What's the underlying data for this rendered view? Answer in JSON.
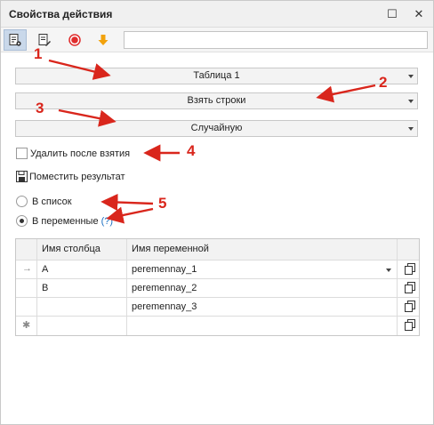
{
  "window": {
    "title": "Свойства действия",
    "maximize_glyph": "☐",
    "close_glyph": "✕"
  },
  "toolbar": {
    "icons": [
      "properties-icon",
      "notes-icon",
      "record-icon",
      "arrow-down-icon"
    ],
    "search_value": ""
  },
  "form": {
    "table_select": "Таблица 1",
    "action_select": "Взять строки",
    "mode_select": "Случайную",
    "delete_after_label": "Удалить после взятия",
    "delete_after_checked": false,
    "place_result_label": "Поместить результат",
    "to_list_label": "В список",
    "to_vars_label": "В переменные",
    "help_label": "(?)",
    "selected_option": "to_vars"
  },
  "grid": {
    "headers": [
      "Имя столбца",
      "Имя переменной"
    ],
    "rows": [
      {
        "column": "A",
        "variable": "peremennay_1",
        "has_dropdown": true
      },
      {
        "column": "B",
        "variable": "peremennay_2",
        "has_dropdown": false
      },
      {
        "column": "",
        "variable": "peremennay_3",
        "has_dropdown": false
      },
      {
        "column": "",
        "variable": "",
        "has_dropdown": false
      }
    ],
    "row_markers": [
      "→",
      "",
      "",
      "✱"
    ]
  },
  "annotations": [
    "1",
    "2",
    "3",
    "4",
    "5"
  ],
  "colors": {
    "annotation": "#d9261c",
    "accent": "#1a6fc2",
    "record": "#e02c2c",
    "arrow_icon": "#f2a20c"
  }
}
